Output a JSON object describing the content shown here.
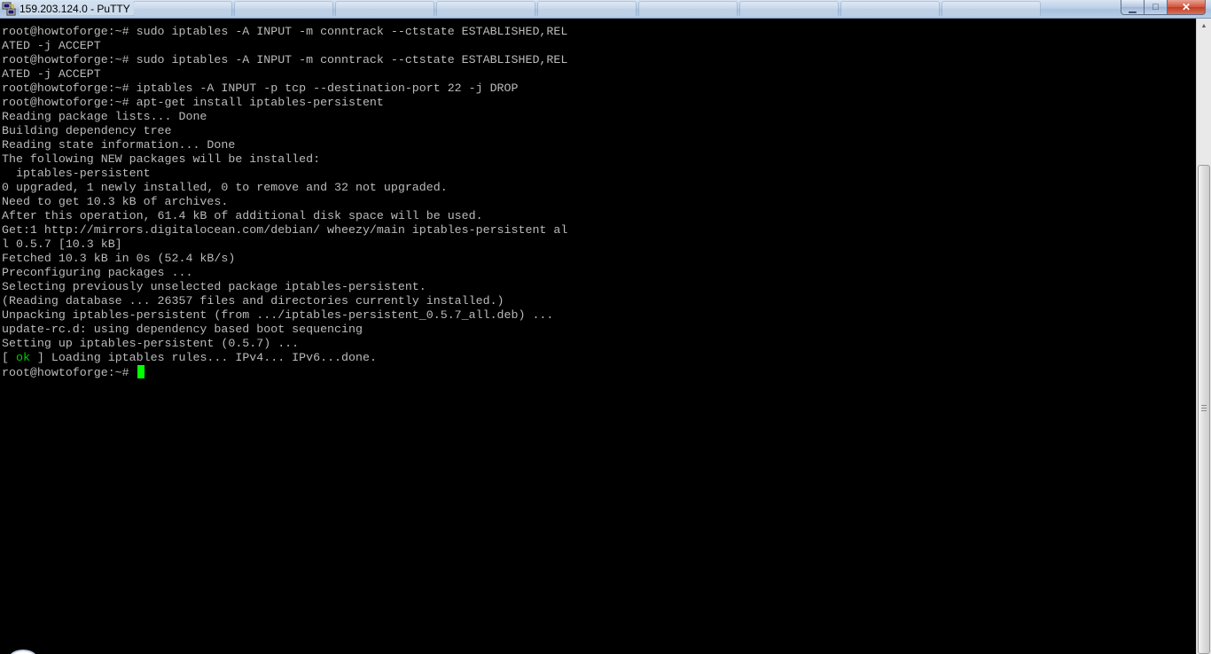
{
  "window": {
    "title": "159.203.124.0 - PuTTY",
    "app_icon": "putty-icon",
    "controls": {
      "minimize_icon": "minimize-icon",
      "maximize_icon": "maximize-icon",
      "close_icon": "close-icon",
      "minimize_glyph": "▁",
      "maximize_glyph": "□",
      "close_glyph": "✕"
    }
  },
  "colors": {
    "terminal_bg": "#000000",
    "terminal_fg": "#bbbbbb",
    "ok_green": "#00cc00",
    "cursor_green": "#00ff00"
  },
  "terminal": {
    "lines": [
      "root@howtoforge:~# sudo iptables -A INPUT -m conntrack --ctstate ESTABLISHED,REL",
      "ATED -j ACCEPT",
      "root@howtoforge:~# sudo iptables -A INPUT -m conntrack --ctstate ESTABLISHED,REL",
      "ATED -j ACCEPT",
      "root@howtoforge:~# iptables -A INPUT -p tcp --destination-port 22 -j DROP",
      "root@howtoforge:~# apt-get install iptables-persistent",
      "Reading package lists... Done",
      "Building dependency tree",
      "Reading state information... Done",
      "The following NEW packages will be installed:",
      "  iptables-persistent",
      "0 upgraded, 1 newly installed, 0 to remove and 32 not upgraded.",
      "Need to get 10.3 kB of archives.",
      "After this operation, 61.4 kB of additional disk space will be used.",
      "Get:1 http://mirrors.digitalocean.com/debian/ wheezy/main iptables-persistent al",
      "l 0.5.7 [10.3 kB]",
      "Fetched 10.3 kB in 0s (52.4 kB/s)",
      "Preconfiguring packages ...",
      "Selecting previously unselected package iptables-persistent.",
      "(Reading database ... 26357 files and directories currently installed.)",
      "Unpacking iptables-persistent (from .../iptables-persistent_0.5.7_all.deb) ...",
      "update-rc.d: using dependency based boot sequencing",
      "Setting up iptables-persistent (0.5.7) ..."
    ],
    "ok_line": {
      "open": "[ ",
      "ok": "ok",
      "rest": " ] Loading iptables rules... IPv4... IPv6...done."
    },
    "prompt": "root@howtoforge:~# "
  },
  "scrollbar": {
    "up_arrow_icon": "scroll-up-arrow-icon",
    "up_glyph": "▲",
    "position_fraction": 0.23
  }
}
